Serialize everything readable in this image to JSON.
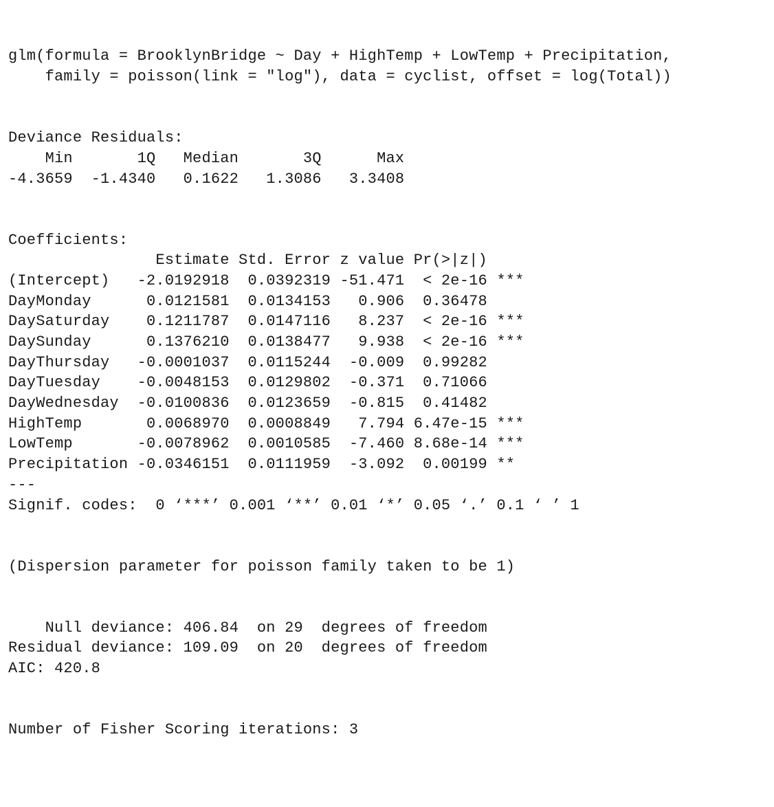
{
  "call": {
    "line1": "glm(formula = BrooklynBridge ~ Day + HighTemp + LowTemp + Precipitation, ",
    "line2": "    family = poisson(link = \"log\"), data = cyclist, offset = log(Total))"
  },
  "deviance_residuals_label": "Deviance Residuals: ",
  "deviance_residuals": {
    "header": "    Min       1Q   Median       3Q      Max  ",
    "values": "-4.3659  -1.4340   0.1622   1.3086   3.3408  ",
    "Min": -4.3659,
    "Q1": -1.434,
    "Median": 0.1622,
    "Q3": 1.3086,
    "Max": 3.3408
  },
  "coefficients_label": "Coefficients:",
  "coefficients": {
    "header": "                Estimate Std. Error z value Pr(>|z|)    ",
    "rows": [
      "(Intercept)   -2.0192918  0.0392319 -51.471  < 2e-16 ***",
      "DayMonday      0.0121581  0.0134153   0.906  0.36478    ",
      "DaySaturday    0.1211787  0.0147116   8.237  < 2e-16 ***",
      "DaySunday      0.1376210  0.0138477   9.938  < 2e-16 ***",
      "DayThursday   -0.0001037  0.0115244  -0.009  0.99282    ",
      "DayTuesday    -0.0048153  0.0129802  -0.371  0.71066    ",
      "DayWednesday  -0.0100836  0.0123659  -0.815  0.41482    ",
      "HighTemp       0.0068970  0.0008849   7.794 6.47e-15 ***",
      "LowTemp       -0.0078962  0.0010585  -7.460 8.68e-14 ***",
      "Precipitation -0.0346151  0.0111959  -3.092  0.00199 ** "
    ],
    "data": [
      {
        "term": "(Intercept)",
        "Estimate": -2.0192918,
        "StdError": 0.0392319,
        "z": -51.471,
        "p": "< 2e-16",
        "sig": "***"
      },
      {
        "term": "DayMonday",
        "Estimate": 0.0121581,
        "StdError": 0.0134153,
        "z": 0.906,
        "p": "0.36478",
        "sig": ""
      },
      {
        "term": "DaySaturday",
        "Estimate": 0.1211787,
        "StdError": 0.0147116,
        "z": 8.237,
        "p": "< 2e-16",
        "sig": "***"
      },
      {
        "term": "DaySunday",
        "Estimate": 0.137621,
        "StdError": 0.0138477,
        "z": 9.938,
        "p": "< 2e-16",
        "sig": "***"
      },
      {
        "term": "DayThursday",
        "Estimate": -0.0001037,
        "StdError": 0.0115244,
        "z": -0.009,
        "p": "0.99282",
        "sig": ""
      },
      {
        "term": "DayTuesday",
        "Estimate": -0.0048153,
        "StdError": 0.0129802,
        "z": -0.371,
        "p": "0.71066",
        "sig": ""
      },
      {
        "term": "DayWednesday",
        "Estimate": -0.0100836,
        "StdError": 0.0123659,
        "z": -0.815,
        "p": "0.41482",
        "sig": ""
      },
      {
        "term": "HighTemp",
        "Estimate": 0.006897,
        "StdError": 0.0008849,
        "z": 7.794,
        "p": "6.47e-15",
        "sig": "***"
      },
      {
        "term": "LowTemp",
        "Estimate": -0.0078962,
        "StdError": 0.0010585,
        "z": -7.46,
        "p": "8.68e-14",
        "sig": "***"
      },
      {
        "term": "Precipitation",
        "Estimate": -0.0346151,
        "StdError": 0.0111959,
        "z": -3.092,
        "p": "0.00199",
        "sig": "**"
      }
    ]
  },
  "separator": "---",
  "signif_codes": "Signif. codes:  0 ‘***’ 0.001 ‘**’ 0.01 ‘*’ 0.05 ‘.’ 0.1 ‘ ’ 1",
  "dispersion": "(Dispersion parameter for poisson family taken to be 1)",
  "deviances": {
    "null_line": "    Null deviance: 406.84  on 29  degrees of freedom",
    "residual_line": "Residual deviance: 109.09  on 20  degrees of freedom",
    "null_deviance": 406.84,
    "null_df": 29,
    "residual_deviance": 109.09,
    "residual_df": 20
  },
  "aic_line": "AIC: 420.8",
  "aic": 420.8,
  "fisher_line": "Number of Fisher Scoring iterations: 3",
  "fisher_iterations": 3
}
